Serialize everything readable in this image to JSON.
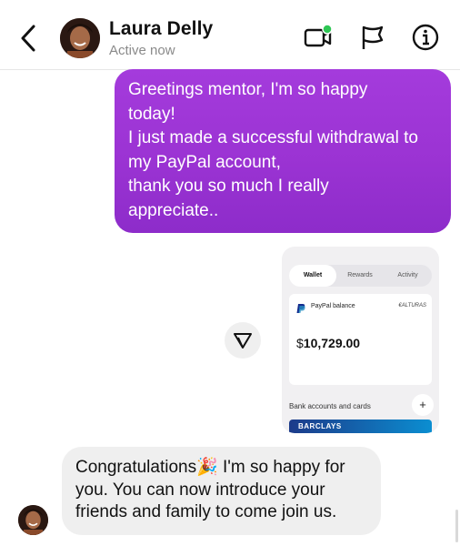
{
  "header": {
    "contact_name": "Laura Delly",
    "status": "Active now",
    "icons": [
      "back-chevron-icon",
      "video-call-icon",
      "flag-icon",
      "info-icon"
    ],
    "online_dot_color": "#2ec654"
  },
  "messages": {
    "outgoing": {
      "lines": [
        "Greetings mentor, I'm so happy",
        "today!",
        "I just made a successful withdrawal to",
        "my PayPal account,",
        "thank you so much I really",
        "appreciate.."
      ],
      "gradient_colors": [
        "#a43bdc",
        "#8d2cca"
      ]
    },
    "attachment": {
      "tabs": [
        "Wallet",
        "Rewards",
        "Activity"
      ],
      "active_tab": "Wallet",
      "paypal_label": "PayPal balance",
      "card_right_text": "€ALTURAS",
      "balance_currency": "$",
      "balance_amount": "10,729.00",
      "banks_label": "Bank accounts and cards",
      "add_symbol": "+",
      "bank_name": "BARCLAYS"
    },
    "incoming": {
      "lines": [
        "Congratulations🎉 I'm so happy for",
        "you. You can now introduce your",
        "friends and family to come join us."
      ]
    }
  }
}
